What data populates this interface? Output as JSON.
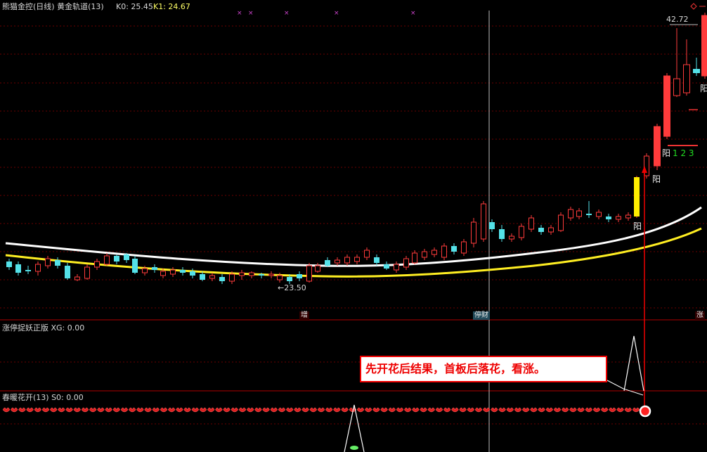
{
  "header": {
    "title": "熊猫金控(日线) 黄金轨道(13)",
    "k0": "K0: 25.45",
    "k1": "K1: 24.67"
  },
  "price_labels": {
    "high": "42.72",
    "low": "←23.50"
  },
  "candle_labels": {
    "yang1": "阳",
    "yang2": "阳",
    "yang3": "阳",
    "yang4": "阳",
    "count": "1 2 3"
  },
  "tags": {
    "zeng": "增",
    "tingcai": "停财",
    "zhang": "涨"
  },
  "panes": {
    "pane2_label": "涨停捉妖正版 XG: 0.00",
    "pane3_label": "春暖花开(13) S0: 0.00"
  },
  "annotation": {
    "text": "先开花后结果，首板后落花，看涨。"
  },
  "colors": {
    "up": "#ff3b3b",
    "down": "#54e1e8",
    "white_line": "#ffffff",
    "yellow_line": "#ffee22",
    "grid": "#6b0000",
    "separator": "#a00000",
    "highlight_candle": "#ffee00"
  }
}
